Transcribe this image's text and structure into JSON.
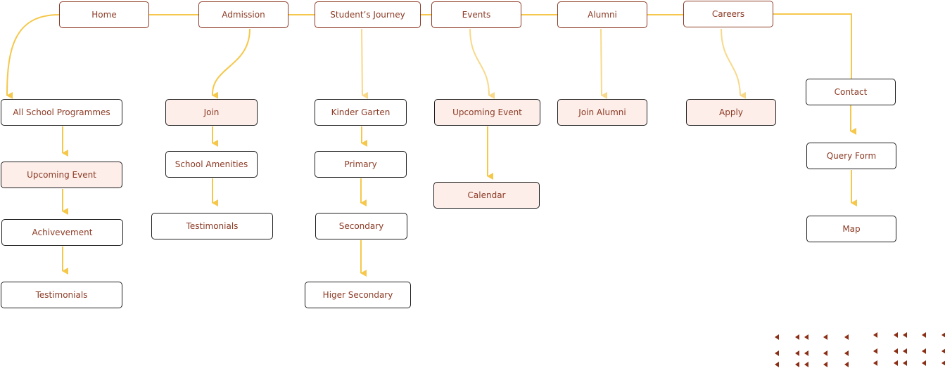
{
  "diagram": {
    "type": "site-map",
    "colors": {
      "top_border": "#8b3a24",
      "child_border": "#1f1f1f",
      "text": "#8b3a24",
      "highlight_fill": "#fdeeea",
      "connector": "#f5c84c",
      "connector_light": "#f8d98a",
      "decor": "#8b2e16"
    },
    "top_nav": [
      {
        "id": "home",
        "label": "Home"
      },
      {
        "id": "admission",
        "label": "Admission"
      },
      {
        "id": "journey",
        "label": "Student’s  Journey"
      },
      {
        "id": "events",
        "label": "Events"
      },
      {
        "id": "alumni",
        "label": "Alumni"
      },
      {
        "id": "careers",
        "label": "Careers"
      }
    ],
    "branches": {
      "home": [
        {
          "label": "All School Programmes",
          "highlight": false
        },
        {
          "label": "Upcoming Event",
          "highlight": true
        },
        {
          "label": "Achivevement",
          "highlight": false
        },
        {
          "label": "Testimonials",
          "highlight": false
        }
      ],
      "admission": [
        {
          "label": "Join",
          "highlight": true
        },
        {
          "label": "School Amenities",
          "highlight": false
        },
        {
          "label": "Testimonials",
          "highlight": false
        }
      ],
      "journey": [
        {
          "label": "Kinder Garten",
          "highlight": false
        },
        {
          "label": "Primary",
          "highlight": false
        },
        {
          "label": "Secondary",
          "highlight": false
        },
        {
          "label": "Higer Secondary",
          "highlight": false
        }
      ],
      "events": [
        {
          "label": "Upcoming Event",
          "highlight": true
        },
        {
          "label": "Calendar",
          "highlight": true
        }
      ],
      "alumni": [
        {
          "label": "Join Alumni",
          "highlight": true
        }
      ],
      "careers": [
        {
          "label": "Apply",
          "highlight": true
        }
      ],
      "contact": [
        {
          "label": "Contact",
          "highlight": false
        },
        {
          "label": "Query Form",
          "highlight": false
        },
        {
          "label": "Map",
          "highlight": false
        }
      ]
    },
    "decor_icon": "left-triangle-pattern"
  }
}
